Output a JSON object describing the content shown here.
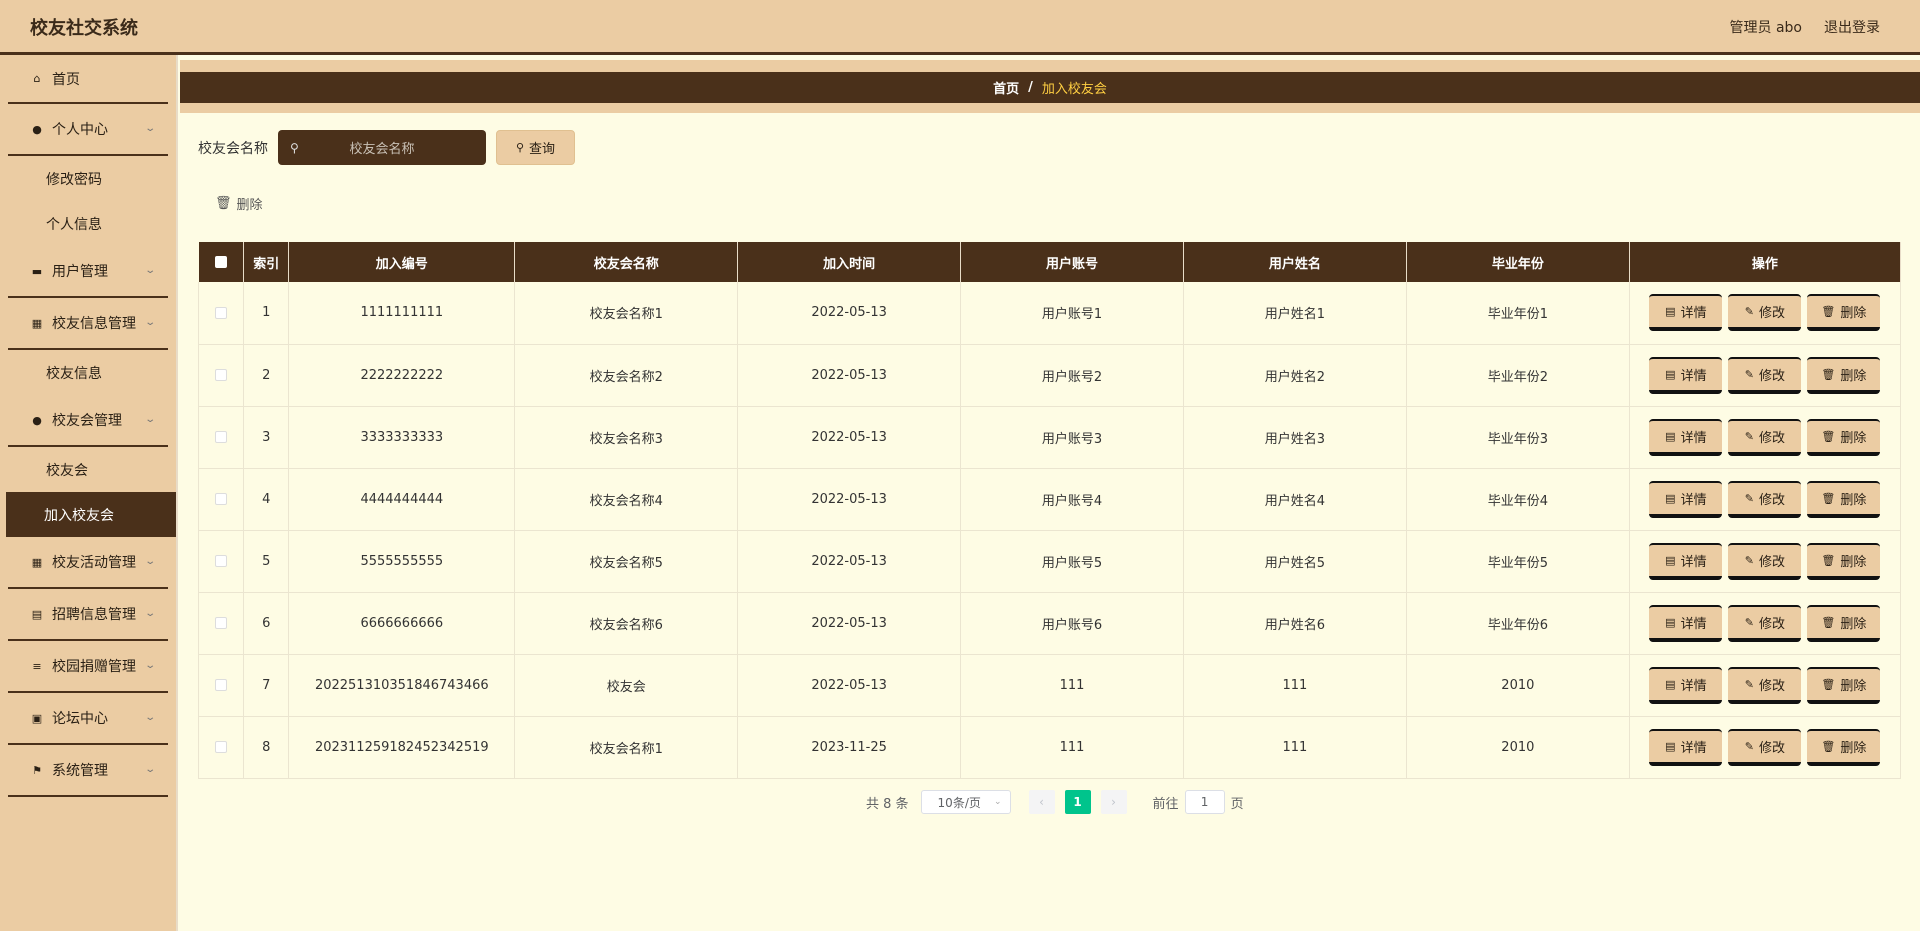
{
  "header": {
    "title": "校友社交系统",
    "user": "管理员 abo",
    "logout": "退出登录"
  },
  "sidebar": {
    "items": [
      {
        "label": "首页",
        "icon": "home-icon",
        "type": "item"
      },
      {
        "label": "个人中心",
        "icon": "user-icon",
        "type": "group"
      },
      {
        "label": "修改密码",
        "type": "sub"
      },
      {
        "label": "个人信息",
        "type": "sub"
      },
      {
        "label": "用户管理",
        "icon": "briefcase-icon",
        "type": "group"
      },
      {
        "label": "校友信息管理",
        "icon": "grid-icon",
        "type": "group"
      },
      {
        "label": "校友信息",
        "type": "sub"
      },
      {
        "label": "校友会管理",
        "icon": "user-icon",
        "type": "group"
      },
      {
        "label": "校友会",
        "type": "sub"
      },
      {
        "label": "加入校友会",
        "type": "sub-active"
      },
      {
        "label": "校友活动管理",
        "icon": "grid-icon",
        "type": "group"
      },
      {
        "label": "招聘信息管理",
        "icon": "document-icon",
        "type": "group"
      },
      {
        "label": "校园捐赠管理",
        "icon": "sliders-icon",
        "type": "group"
      },
      {
        "label": "论坛中心",
        "icon": "clipboard-icon",
        "type": "group"
      },
      {
        "label": "系统管理",
        "icon": "flag-icon",
        "type": "group"
      }
    ]
  },
  "breadcrumb": {
    "home": "首页",
    "separator": "/",
    "current": "加入校友会"
  },
  "search": {
    "label": "校友会名称",
    "placeholder": "校友会名称",
    "button": "查询"
  },
  "toolbar": {
    "delete_label": "删除"
  },
  "table": {
    "headers": [
      "索引",
      "加入编号",
      "校友会名称",
      "加入时间",
      "用户账号",
      "用户姓名",
      "毕业年份",
      "操作"
    ],
    "rows": [
      [
        "1",
        "1111111111",
        "校友会名称1",
        "2022-05-13",
        "用户账号1",
        "用户姓名1",
        "毕业年份1"
      ],
      [
        "2",
        "2222222222",
        "校友会名称2",
        "2022-05-13",
        "用户账号2",
        "用户姓名2",
        "毕业年份2"
      ],
      [
        "3",
        "3333333333",
        "校友会名称3",
        "2022-05-13",
        "用户账号3",
        "用户姓名3",
        "毕业年份3"
      ],
      [
        "4",
        "4444444444",
        "校友会名称4",
        "2022-05-13",
        "用户账号4",
        "用户姓名4",
        "毕业年份4"
      ],
      [
        "5",
        "5555555555",
        "校友会名称5",
        "2022-05-13",
        "用户账号5",
        "用户姓名5",
        "毕业年份5"
      ],
      [
        "6",
        "6666666666",
        "校友会名称6",
        "2022-05-13",
        "用户账号6",
        "用户姓名6",
        "毕业年份6"
      ],
      [
        "7",
        "20225131035184674346​6",
        "校友会",
        "2022-05-13",
        "111",
        "111",
        "2010"
      ],
      [
        "8",
        "20231125918245234251​9",
        "校友会名称1",
        "2023-11-25",
        "111",
        "111",
        "2010"
      ]
    ],
    "actions": {
      "detail": "详情",
      "edit": "修改",
      "delete": "删除"
    }
  },
  "pagination": {
    "total": "共 8 条",
    "page_size": "10条/页",
    "current_page": "1",
    "goto_prefix": "前往",
    "goto_value": "1",
    "goto_suffix": "页"
  },
  "colors": {
    "accent_dark": "#4a301a",
    "accent_light": "#ebcca3",
    "background": "#fefce4",
    "breadcrumb_current": "#ffcf42",
    "page_active": "#00c48c"
  }
}
